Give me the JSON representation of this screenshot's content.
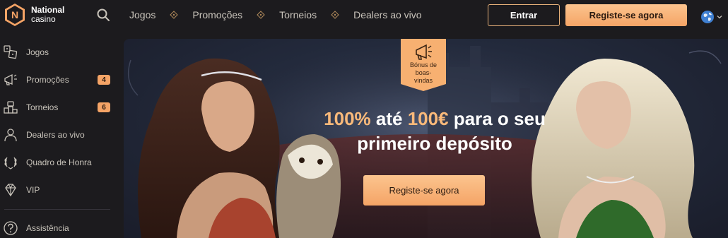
{
  "brand": {
    "name_line1": "National",
    "name_line2": "casino",
    "badge_letter": "N"
  },
  "header": {
    "nav": [
      {
        "label": "Jogos"
      },
      {
        "label": "Promoções"
      },
      {
        "label": "Torneios"
      },
      {
        "label": "Dealers ao vivo"
      }
    ],
    "login_label": "Entrar",
    "register_label": "Registe-se agora"
  },
  "sidebar": {
    "items": [
      {
        "label": "Jogos",
        "icon": "games-icon"
      },
      {
        "label": "Promoções",
        "icon": "megaphone-icon",
        "badge": "4"
      },
      {
        "label": "Torneios",
        "icon": "tournament-icon",
        "badge": "6"
      },
      {
        "label": "Dealers ao vivo",
        "icon": "dealer-icon"
      },
      {
        "label": "Quadro de Honra",
        "icon": "laurel-icon"
      },
      {
        "label": "VIP",
        "icon": "diamond-icon"
      },
      {
        "label": "Assistência",
        "icon": "help-icon"
      }
    ]
  },
  "banner": {
    "tag": {
      "line1": "Bónus de",
      "line2": "boas-",
      "line3": "vindas"
    },
    "headline": {
      "part1": "100%",
      "part2": " até ",
      "part3": "100€",
      "part4": " para o seu",
      "line2": "primeiro depósito"
    },
    "cta_label": "Registe-se agora"
  },
  "colors": {
    "accent": "#f5a466",
    "accent_light": "#fbc48e",
    "background": "#1c1b1e"
  }
}
